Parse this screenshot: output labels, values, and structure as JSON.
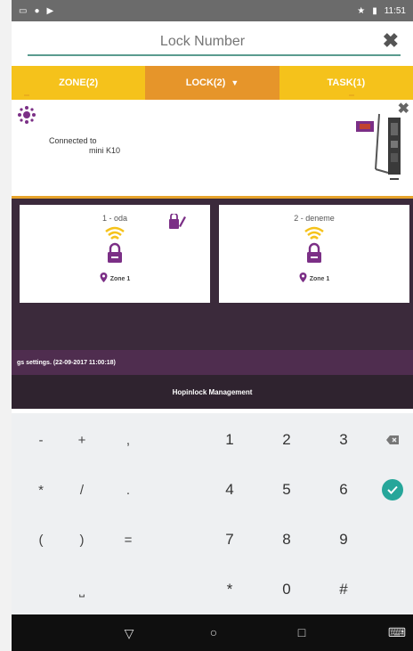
{
  "status_bar": {
    "time": "11:51",
    "left_icons": [
      "screen-icon",
      "location-icon",
      "cast-icon"
    ],
    "right_icons": [
      "star-icon",
      "battery-icon"
    ]
  },
  "search": {
    "placeholder": "Lock Number",
    "value": "",
    "clear_label": "✖"
  },
  "tabs": [
    {
      "label": "ZONE(2)",
      "active": false
    },
    {
      "label": "LOCK(2)",
      "active": true
    },
    {
      "label": "TASK(1)",
      "active": false
    }
  ],
  "connection": {
    "line1": "Connected to",
    "line2": "mini K10",
    "close_label": "✖"
  },
  "locks": [
    {
      "title": "1 - oda",
      "zone": "Zone 1",
      "editable": true
    },
    {
      "title": "2 - deneme",
      "zone": "Zone 1",
      "editable": false
    }
  ],
  "settings_text": "gs settings. (22-09-2017 11:00:18)",
  "management_title": "Hopinlock Management",
  "keypad": {
    "rows": [
      [
        "-",
        "+",
        ",",
        "1",
        "2",
        "3",
        "⌫"
      ],
      [
        "*",
        "/",
        ".",
        "4",
        "5",
        "6",
        "✓"
      ],
      [
        "(",
        ")",
        "=",
        "7",
        "8",
        "9",
        ""
      ],
      [
        "",
        "⎵",
        "",
        "*",
        "0",
        "#",
        ""
      ]
    ]
  },
  "navbar": {
    "back": "▽",
    "home": "○",
    "recents": "□",
    "keyboard": "⌨"
  },
  "colors": {
    "tab_yellow": "#f5c21b",
    "tab_active": "#e6952a",
    "purple_dark": "#3b2a3b",
    "purple_bar": "#4f2d4f",
    "accent_purple": "#7b2f86",
    "wifi_yellow": "#f5c21b",
    "check_teal": "#26a69a"
  }
}
